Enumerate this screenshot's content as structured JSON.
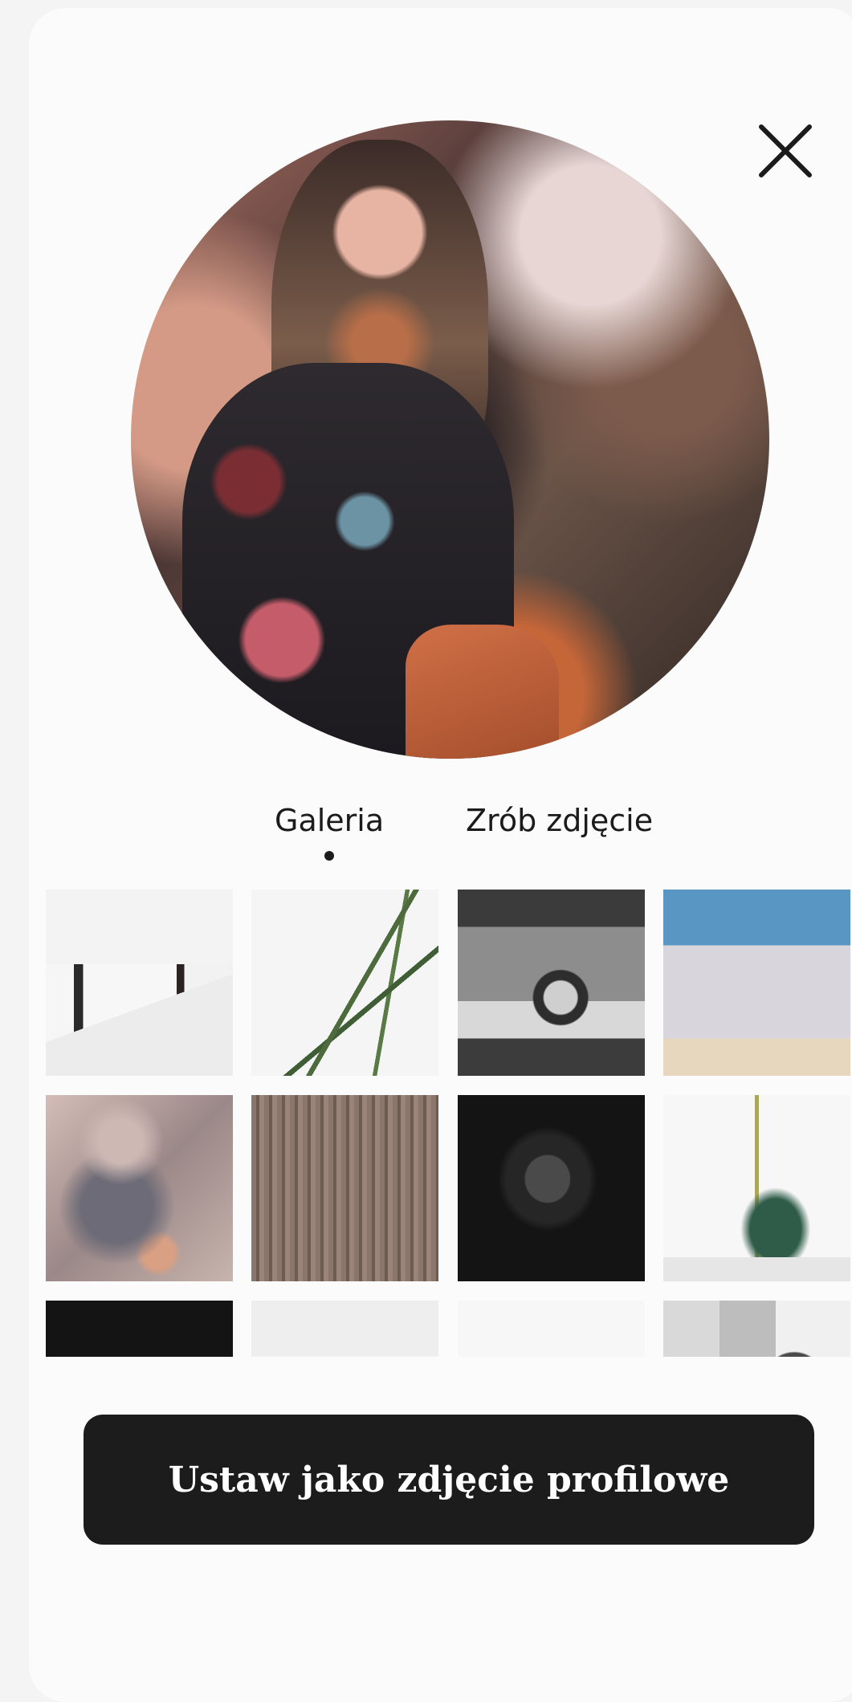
{
  "tabs": [
    {
      "label": "Galeria",
      "active": true
    },
    {
      "label": "Zrób zdjęcie",
      "active": false
    }
  ],
  "gallery": {
    "rows_visible": 3,
    "columns": 4
  },
  "primary_action": {
    "label": "Ustaw jako zdjęcie profilowe"
  },
  "colors": {
    "button_bg": "#1c1c1c",
    "button_text": "#ffffff",
    "sheet_bg": "#fbfbfb",
    "text": "#1b1b1b"
  },
  "icons": {
    "close": "close-icon"
  }
}
